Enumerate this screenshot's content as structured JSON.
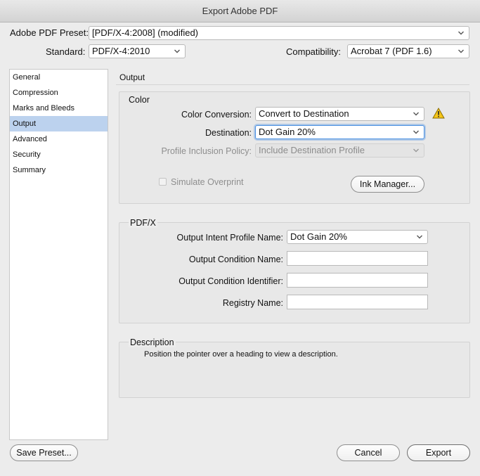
{
  "window": {
    "title": "Export Adobe PDF"
  },
  "header": {
    "preset_label": "Adobe PDF Preset:",
    "preset_value": "[PDF/X-4:2008] (modified)",
    "standard_label": "Standard:",
    "standard_value": "PDF/X-4:2010",
    "compat_label": "Compatibility:",
    "compat_value": "Acrobat 7 (PDF 1.6)"
  },
  "sidebar": {
    "items": [
      {
        "label": "General"
      },
      {
        "label": "Compression"
      },
      {
        "label": "Marks and Bleeds"
      },
      {
        "label": "Output"
      },
      {
        "label": "Advanced"
      },
      {
        "label": "Security"
      },
      {
        "label": "Summary"
      }
    ],
    "active_index": 3
  },
  "main": {
    "section_title": "Output",
    "color": {
      "title": "Color",
      "conversion_label": "Color Conversion:",
      "conversion_value": "Convert to Destination",
      "destination_label": "Destination:",
      "destination_value": "Dot Gain 20%",
      "profile_label": "Profile Inclusion Policy:",
      "profile_value": "Include Destination Profile",
      "simulate_label": "Simulate Overprint",
      "ink_manager_label": "Ink Manager..."
    },
    "pdfx": {
      "title": "PDF/X",
      "intent_label": "Output Intent Profile Name:",
      "intent_value": "Dot Gain 20%",
      "condition_name_label": "Output Condition Name:",
      "condition_name_value": "",
      "condition_id_label": "Output Condition Identifier:",
      "condition_id_value": "",
      "registry_label": "Registry Name:",
      "registry_value": ""
    },
    "description": {
      "title": "Description",
      "text": "Position the pointer over a heading to view a description."
    }
  },
  "footer": {
    "save_preset_label": "Save Preset...",
    "cancel_label": "Cancel",
    "export_label": "Export"
  },
  "icons": {
    "warning": "warning-icon",
    "chevron": "chevron-down-icon"
  },
  "colors": {
    "active_sidebar": "#bcd2ee",
    "focus_ring": "#4a90e2",
    "warning_fill": "#f5c518"
  }
}
